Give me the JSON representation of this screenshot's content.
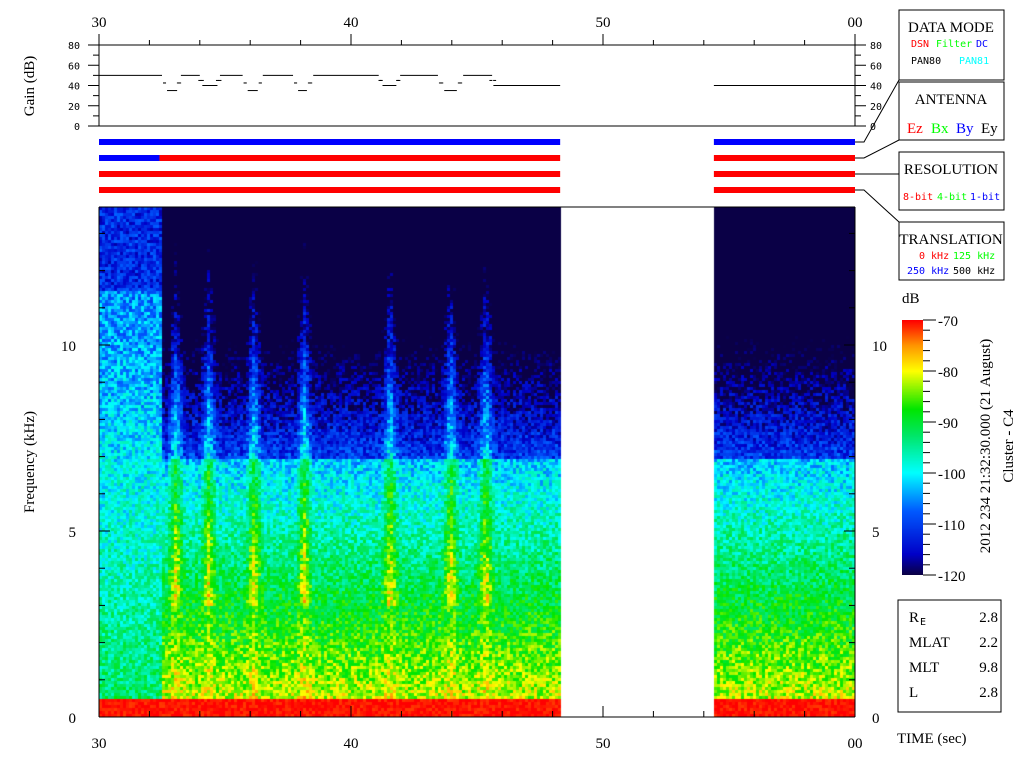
{
  "chart_data": {
    "type": "heatmap",
    "title": "Cluster - C4",
    "timestamp": "2012 234 21:32:30.000 (21 August)",
    "xlabel": "TIME (sec)",
    "ylabel": "Frequency (kHz)",
    "xlim": [
      30,
      60
    ],
    "ylim": [
      0,
      13.7
    ],
    "x_ticks": [
      {
        "v": 30,
        "label": "30"
      },
      {
        "v": 40,
        "label": "40"
      },
      {
        "v": 50,
        "label": "50"
      },
      {
        "v": 60,
        "label": "00"
      }
    ],
    "y_ticks": [
      {
        "v": 0,
        "label": "0"
      },
      {
        "v": 5,
        "label": "5"
      },
      {
        "v": 10,
        "label": "10"
      }
    ],
    "data_gaps": [
      [
        48.3,
        54.4
      ]
    ],
    "gain_panel": {
      "ylabel": "Gain (dB)",
      "ylim": [
        0,
        80
      ],
      "y_ticks": [
        {
          "v": 0,
          "label": "0"
        },
        {
          "v": 20,
          "label": "20"
        },
        {
          "v": 40,
          "label": "40"
        },
        {
          "v": 60,
          "label": "60"
        },
        {
          "v": 80,
          "label": "80"
        }
      ],
      "segments": [
        [
          30.0,
          32.5,
          50
        ],
        [
          32.7,
          33.1,
          35
        ],
        [
          33.25,
          34.0,
          50
        ],
        [
          34.1,
          34.7,
          40
        ],
        [
          34.8,
          35.7,
          50
        ],
        [
          35.9,
          36.3,
          35
        ],
        [
          36.5,
          37.7,
          50
        ],
        [
          37.9,
          38.25,
          35
        ],
        [
          38.5,
          41.1,
          50
        ],
        [
          41.25,
          41.8,
          40
        ],
        [
          41.95,
          43.45,
          50
        ],
        [
          43.7,
          44.2,
          35
        ],
        [
          44.45,
          45.6,
          50
        ],
        [
          45.65,
          48.3,
          40
        ],
        [
          54.4,
          60.0,
          40
        ]
      ]
    },
    "status_bars": [
      {
        "name": "data-mode",
        "segments": [
          [
            30,
            48.3,
            "#0000ff"
          ],
          [
            54.4,
            60,
            "#0000ff"
          ]
        ]
      },
      {
        "name": "antenna",
        "segments": [
          [
            30,
            32.4,
            "#0000ff"
          ],
          [
            32.4,
            48.3,
            "#ff0000"
          ],
          [
            54.4,
            60,
            "#ff0000"
          ]
        ]
      },
      {
        "name": "resolution",
        "segments": [
          [
            30,
            48.3,
            "#ff0000"
          ],
          [
            54.4,
            60,
            "#ff0000"
          ]
        ]
      },
      {
        "name": "translation",
        "segments": [
          [
            30,
            48.3,
            "#ff0000"
          ],
          [
            54.4,
            60,
            "#ff0000"
          ]
        ]
      }
    ],
    "colorbar": {
      "label": "dB",
      "range": [
        -120,
        -70
      ],
      "ticks": [
        {
          "v": -70,
          "label": "-70"
        },
        {
          "v": -80,
          "label": "-80"
        },
        {
          "v": -90,
          "label": "-90"
        },
        {
          "v": -100,
          "label": "-100"
        },
        {
          "v": -110,
          "label": "-110"
        },
        {
          "v": -120,
          "label": "-120"
        }
      ]
    }
  },
  "legend": {
    "data_mode": {
      "title": "DATA MODE",
      "items": [
        {
          "text": "DSN",
          "color": "#ff0000"
        },
        {
          "text": "Filter",
          "color": "#00ff00"
        },
        {
          "text": "DC",
          "color": "#0000ff"
        },
        {
          "text": "PAN80",
          "color": "#000000"
        },
        {
          "text": "PAN81",
          "color": "#00ffff"
        }
      ]
    },
    "antenna": {
      "title": "ANTENNA",
      "items": [
        {
          "text": "Ez",
          "color": "#ff0000"
        },
        {
          "text": "Bx",
          "color": "#00ff00"
        },
        {
          "text": "By",
          "color": "#0000ff"
        },
        {
          "text": "Ey",
          "color": "#000000"
        }
      ]
    },
    "resolution": {
      "title": "RESOLUTION",
      "items": [
        {
          "text": "8-bit",
          "color": "#ff0000"
        },
        {
          "text": "4-bit",
          "color": "#00ff00"
        },
        {
          "text": "1-bit",
          "color": "#0000ff"
        }
      ]
    },
    "translation": {
      "title": "TRANSLATION",
      "items": [
        {
          "text": "0 kHz",
          "color": "#ff0000"
        },
        {
          "text": "125 kHz",
          "color": "#00ff00"
        },
        {
          "text": "250 kHz",
          "color": "#0000ff"
        },
        {
          "text": "500 kHz",
          "color": "#000000"
        }
      ]
    }
  },
  "orbit": [
    {
      "label": "R",
      "sub": "E",
      "value": "2.8"
    },
    {
      "label": "MLAT",
      "sub": "",
      "value": "2.2"
    },
    {
      "label": "MLT",
      "sub": "",
      "value": "9.8"
    },
    {
      "label": "L",
      "sub": "",
      "value": "2.8"
    }
  ]
}
